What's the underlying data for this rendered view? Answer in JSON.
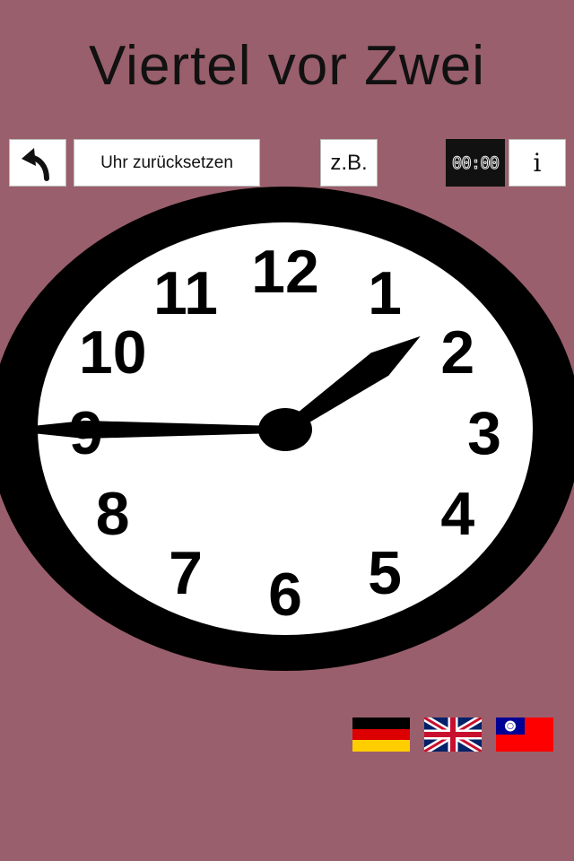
{
  "title": "Viertel vor Zwei",
  "toolbar": {
    "back_icon": "curved-back-arrow-icon",
    "reset_label": "Uhr zurücksetzen",
    "example_label": "z.B.",
    "digital_label": "00:00",
    "info_label": "i"
  },
  "clock": {
    "numerals": [
      "12",
      "1",
      "2",
      "3",
      "4",
      "5",
      "6",
      "7",
      "8",
      "9",
      "10",
      "11"
    ],
    "time": {
      "hour": 1,
      "minute": 45
    }
  },
  "languages": [
    {
      "name": "german-flag-icon"
    },
    {
      "name": "uk-flag-icon"
    },
    {
      "name": "taiwan-flag-icon"
    }
  ]
}
